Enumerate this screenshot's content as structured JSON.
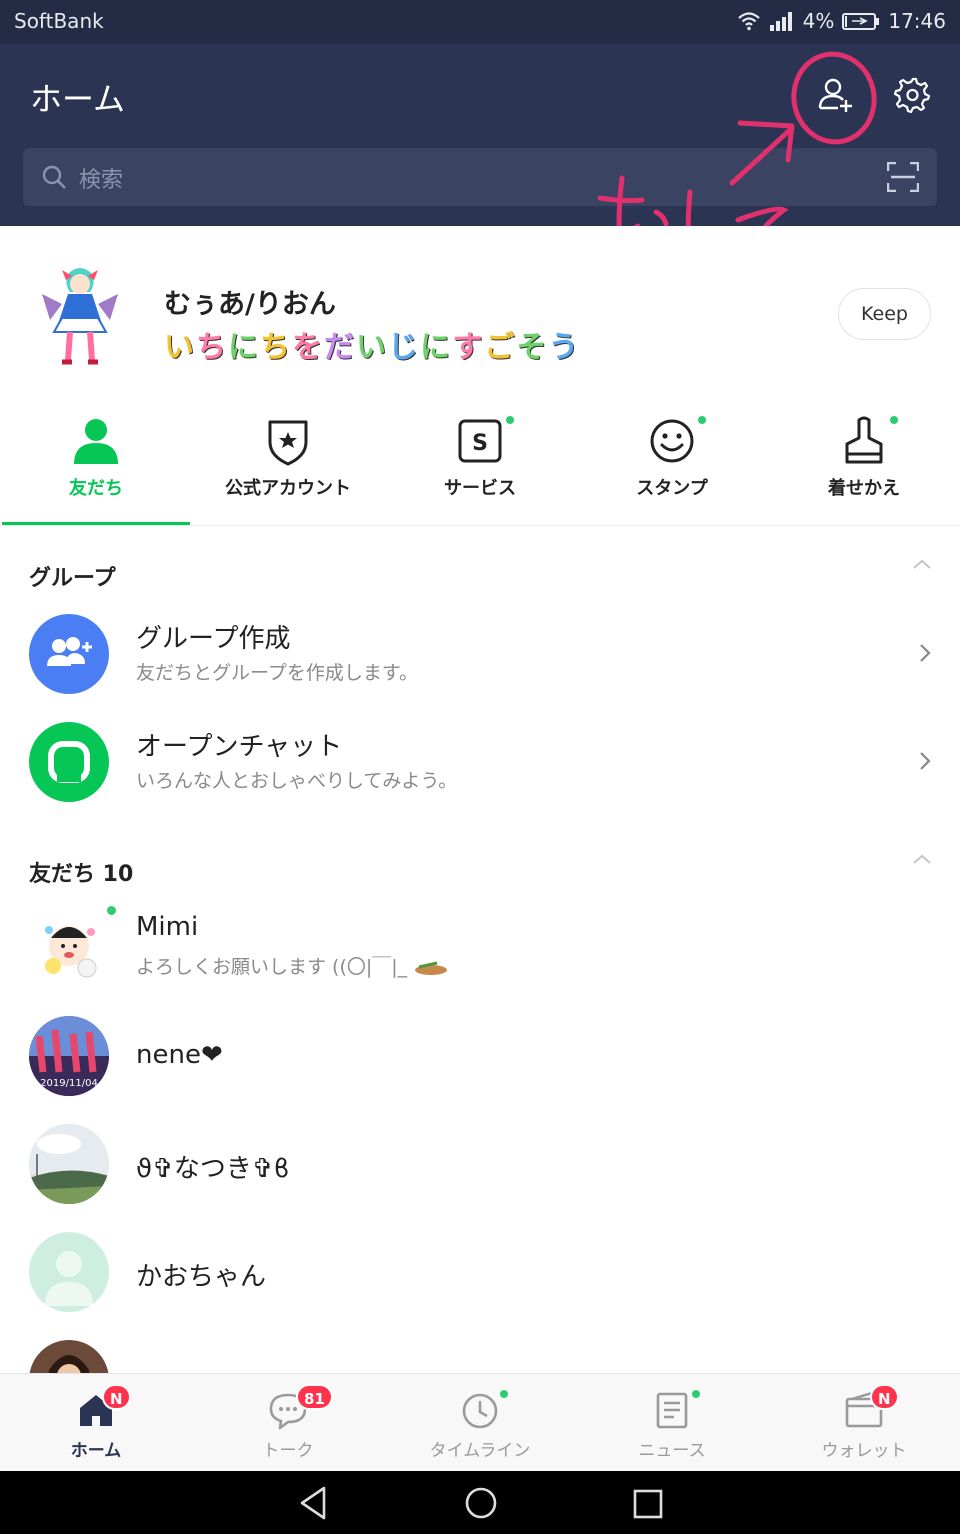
{
  "status_bar": {
    "carrier": "SoftBank",
    "battery": "4%",
    "time": "17:46"
  },
  "header": {
    "title": "ホーム",
    "search_placeholder": "検索"
  },
  "annotation": {
    "handwritten_text": "おして"
  },
  "profile": {
    "name": "むぅあ/りおん",
    "status_message": [
      "い",
      "ち",
      "に",
      "ち",
      "を",
      "だ",
      "い",
      "じ",
      "に",
      "す",
      "ご",
      "そ",
      "う"
    ],
    "status_colors": [
      "#f2c230",
      "#ff7aa8",
      "#6fd36b",
      "#f2c230",
      "#ff7aa8",
      "#c88af0",
      "#6fd36b",
      "#5aa8f0",
      "#6fd36b",
      "#ff7aa8",
      "#f2c230",
      "#6fd36b",
      "#5aa8f0"
    ],
    "keep_label": "Keep"
  },
  "category_tabs": [
    {
      "label": "友だち",
      "icon": "person-icon",
      "active": true
    },
    {
      "label": "公式アカウント",
      "icon": "shield-star-icon"
    },
    {
      "label": "サービス",
      "icon": "service-s-icon",
      "dot": true
    },
    {
      "label": "スタンプ",
      "icon": "smiley-icon",
      "dot": true
    },
    {
      "label": "着せかえ",
      "icon": "brush-icon",
      "dot": true
    }
  ],
  "groups_section": {
    "title": "グループ",
    "items": [
      {
        "title": "グループ作成",
        "subtitle": "友だちとグループを作成します。"
      },
      {
        "title": "オープンチャット",
        "subtitle": "いろんな人とおしゃべりしてみよう。"
      }
    ]
  },
  "friends_section": {
    "title": "友だち 10",
    "items": [
      {
        "name": "Mimi",
        "status": "よろしくお願いします ((〇|￣|_"
      },
      {
        "name": "nene❤",
        "avatar_caption": "2019/11/04"
      },
      {
        "name": "ϑ✞なつき✞ϐ"
      },
      {
        "name": "かおちゃん"
      }
    ]
  },
  "bottom_nav": [
    {
      "label": "ホーム",
      "icon": "home-icon",
      "badge": "N",
      "active": true
    },
    {
      "label": "トーク",
      "icon": "chat-bubble-icon",
      "badge": "81"
    },
    {
      "label": "タイムライン",
      "icon": "clock-icon",
      "dot": true
    },
    {
      "label": "ニュース",
      "icon": "news-icon",
      "dot": true
    },
    {
      "label": "ウォレット",
      "icon": "wallet-icon",
      "badge": "N"
    }
  ],
  "colors": {
    "header_bg": "#2b3452",
    "accent_green": "#06c755",
    "badge_red": "#ff334b",
    "annotation_pink": "#e0306e"
  }
}
